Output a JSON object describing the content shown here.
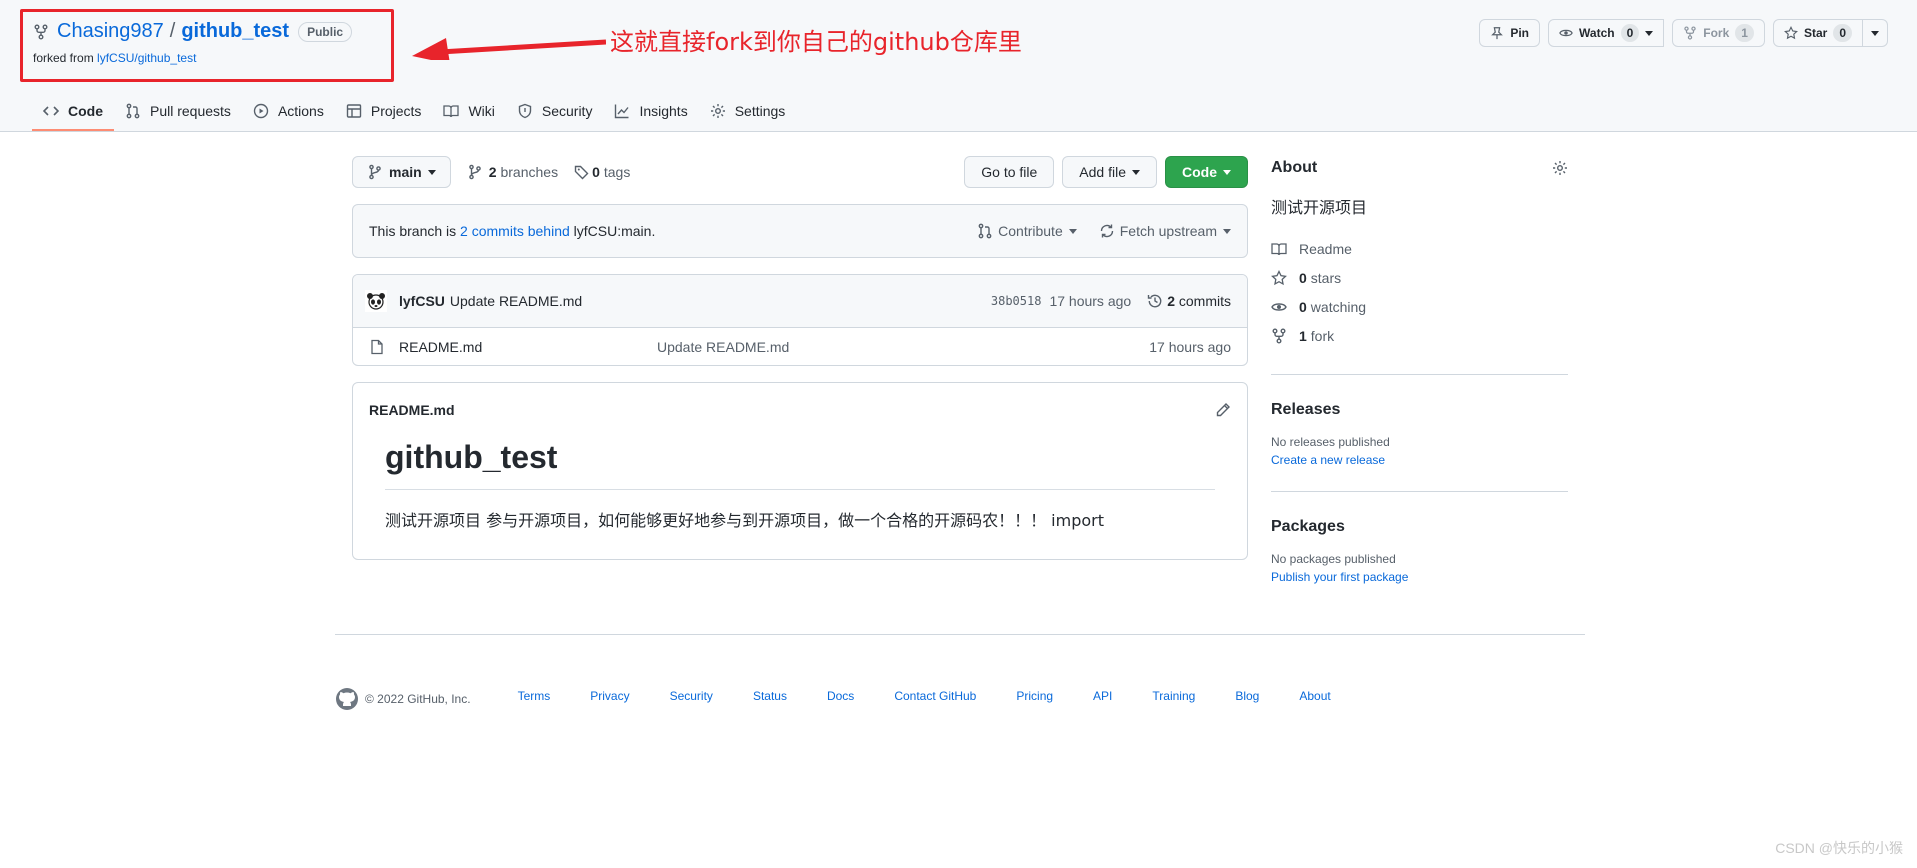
{
  "repo": {
    "owner": "Chasing987",
    "separator": "/",
    "name": "github_test",
    "visibility": "Public",
    "forked_prefix": "forked from",
    "forked_link": "lyfCSU/github_test"
  },
  "annotation": {
    "text": "这就直接fork到你自己的github仓库里",
    "color": "#e8242b"
  },
  "actions": {
    "pin": "Pin",
    "watch": "Watch",
    "watch_count": "0",
    "fork": "Fork",
    "fork_count": "1",
    "star": "Star",
    "star_count": "0"
  },
  "tabs": [
    {
      "label": "Code",
      "icon": "code-icon"
    },
    {
      "label": "Pull requests",
      "icon": "git-pull-request-icon"
    },
    {
      "label": "Actions",
      "icon": "play-icon"
    },
    {
      "label": "Projects",
      "icon": "table-icon"
    },
    {
      "label": "Wiki",
      "icon": "book-icon"
    },
    {
      "label": "Security",
      "icon": "shield-icon"
    },
    {
      "label": "Insights",
      "icon": "graph-icon"
    },
    {
      "label": "Settings",
      "icon": "gear-icon"
    }
  ],
  "filenav": {
    "branch": "main",
    "branches_count": "2",
    "branches_label": "branches",
    "tags_count": "0",
    "tags_label": "tags",
    "go_to_file": "Go to file",
    "add_file": "Add file",
    "code": "Code"
  },
  "branch_info": {
    "prefix": "This branch is",
    "link": "2 commits behind",
    "suffix": "lyfCSU:main.",
    "contribute": "Contribute",
    "fetch": "Fetch upstream"
  },
  "latest_commit": {
    "author": "lyfCSU",
    "message": "Update README.md",
    "sha": "38b0518",
    "time": "17 hours ago",
    "commits_count": "2",
    "commits_label": "commits"
  },
  "files": [
    {
      "name": "README.md",
      "message": "Update README.md",
      "age": "17 hours ago"
    }
  ],
  "readme": {
    "filename": "README.md",
    "heading": "github_test",
    "body": "测试开源项目 参与开源项目，如何能够更好地参与到开源项目，做一个合格的开源码农！！！ import"
  },
  "about": {
    "title": "About",
    "description": "测试开源项目",
    "readme": "Readme",
    "stars_count": "0",
    "stars_label": "stars",
    "watching_count": "0",
    "watching_label": "watching",
    "fork_count": "1",
    "fork_label": "fork"
  },
  "releases": {
    "title": "Releases",
    "empty": "No releases published",
    "link": "Create a new release"
  },
  "packages": {
    "title": "Packages",
    "empty": "No packages published",
    "link": "Publish your first package"
  },
  "footer": {
    "copyright": "© 2022 GitHub, Inc.",
    "links": [
      "Terms",
      "Privacy",
      "Security",
      "Status",
      "Docs",
      "Contact GitHub",
      "Pricing",
      "API",
      "Training",
      "Blog",
      "About"
    ]
  },
  "watermark": "CSDN @快乐的小猴"
}
